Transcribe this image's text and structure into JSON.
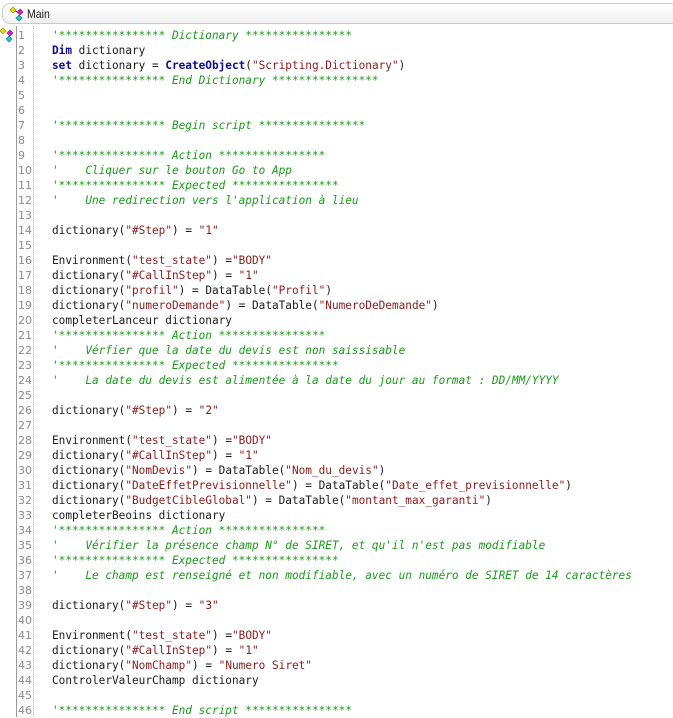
{
  "tab": {
    "label": "Main",
    "icon": "action-diamonds-icon"
  },
  "gutter": {
    "marker_icon": "action-diamonds-icon"
  },
  "colors": {
    "keyword": "#0a0a8c",
    "string": "#8b1a1a",
    "comment": "#1a9a1a",
    "line_number": "#8a8a8a",
    "text": "#1a1a1a"
  },
  "lines": [
    {
      "n": "1",
      "tokens": [
        [
          "cm",
          "'**************** Dictionary ****************"
        ]
      ]
    },
    {
      "n": "2",
      "tokens": [
        [
          "kw",
          "Dim"
        ],
        [
          "op",
          " dictionary"
        ]
      ]
    },
    {
      "n": "3",
      "tokens": [
        [
          "kw",
          "set"
        ],
        [
          "op",
          " dictionary = "
        ],
        [
          "fn",
          "CreateObject"
        ],
        [
          "op",
          "("
        ],
        [
          "str",
          "\"Scripting.Dictionary\""
        ],
        [
          "op",
          ")"
        ]
      ]
    },
    {
      "n": "4",
      "tokens": [
        [
          "cm",
          "'**************** End Dictionary ****************"
        ]
      ]
    },
    {
      "n": "5",
      "tokens": []
    },
    {
      "n": "6",
      "tokens": []
    },
    {
      "n": "7",
      "tokens": [
        [
          "cm",
          "'**************** Begin script ****************"
        ]
      ]
    },
    {
      "n": "8",
      "tokens": []
    },
    {
      "n": "9",
      "tokens": [
        [
          "cm",
          "'**************** Action ****************"
        ]
      ]
    },
    {
      "n": "10",
      "tokens": [
        [
          "cm",
          "'    Cliquer sur le bouton Go to App"
        ]
      ]
    },
    {
      "n": "11",
      "tokens": [
        [
          "cm",
          "'**************** Expected ****************"
        ]
      ]
    },
    {
      "n": "12",
      "tokens": [
        [
          "cm",
          "'    Une redirection vers l'application à lieu"
        ]
      ]
    },
    {
      "n": "13",
      "tokens": []
    },
    {
      "n": "14",
      "tokens": [
        [
          "op",
          "dictionary("
        ],
        [
          "str",
          "\"#Step\""
        ],
        [
          "op",
          ") = "
        ],
        [
          "str",
          "\"1\""
        ]
      ]
    },
    {
      "n": "15",
      "tokens": []
    },
    {
      "n": "16",
      "tokens": [
        [
          "op",
          "Environment("
        ],
        [
          "str",
          "\"test_state\""
        ],
        [
          "op",
          ") ="
        ],
        [
          "str",
          "\"BODY\""
        ]
      ]
    },
    {
      "n": "17",
      "tokens": [
        [
          "op",
          "dictionary("
        ],
        [
          "str",
          "\"#CallInStep\""
        ],
        [
          "op",
          ") = "
        ],
        [
          "str",
          "\"1\""
        ]
      ]
    },
    {
      "n": "18",
      "tokens": [
        [
          "op",
          "dictionary("
        ],
        [
          "str",
          "\"profil\""
        ],
        [
          "op",
          ") = DataTable("
        ],
        [
          "str",
          "\"Profil\""
        ],
        [
          "op",
          ")"
        ]
      ]
    },
    {
      "n": "19",
      "tokens": [
        [
          "op",
          "dictionary("
        ],
        [
          "str",
          "\"numeroDemande\""
        ],
        [
          "op",
          ") = DataTable("
        ],
        [
          "str",
          "\"NumeroDeDemande\""
        ],
        [
          "op",
          ")"
        ]
      ]
    },
    {
      "n": "20",
      "tokens": [
        [
          "op",
          "completerLanceur dictionary"
        ]
      ]
    },
    {
      "n": "21",
      "tokens": [
        [
          "cm",
          "'**************** Action ****************"
        ]
      ]
    },
    {
      "n": "22",
      "tokens": [
        [
          "cm",
          "'    Vérfier que la date du devis est non saissisable"
        ]
      ]
    },
    {
      "n": "23",
      "tokens": [
        [
          "cm",
          "'**************** Expected ****************"
        ]
      ]
    },
    {
      "n": "24",
      "tokens": [
        [
          "cm",
          "'    La date du devis est alimentée à la date du jour au format : DD/MM/YYYY"
        ]
      ]
    },
    {
      "n": "25",
      "tokens": []
    },
    {
      "n": "26",
      "tokens": [
        [
          "op",
          "dictionary("
        ],
        [
          "str",
          "\"#Step\""
        ],
        [
          "op",
          ") = "
        ],
        [
          "str",
          "\"2\""
        ]
      ]
    },
    {
      "n": "27",
      "tokens": []
    },
    {
      "n": "28",
      "tokens": [
        [
          "op",
          "Environment("
        ],
        [
          "str",
          "\"test_state\""
        ],
        [
          "op",
          ") ="
        ],
        [
          "str",
          "\"BODY\""
        ]
      ]
    },
    {
      "n": "29",
      "tokens": [
        [
          "op",
          "dictionary("
        ],
        [
          "str",
          "\"#CallInStep\""
        ],
        [
          "op",
          ") = "
        ],
        [
          "str",
          "\"1\""
        ]
      ]
    },
    {
      "n": "30",
      "tokens": [
        [
          "op",
          "dictionary("
        ],
        [
          "str",
          "\"NomDevis\""
        ],
        [
          "op",
          ") = DataTable("
        ],
        [
          "str",
          "\"Nom_du_devis\""
        ],
        [
          "op",
          ")"
        ]
      ]
    },
    {
      "n": "31",
      "tokens": [
        [
          "op",
          "dictionary("
        ],
        [
          "str",
          "\"DateEffetPrevisionnelle\""
        ],
        [
          "op",
          ") = DataTable("
        ],
        [
          "str",
          "\"Date_effet_previsionnelle\""
        ],
        [
          "op",
          ")"
        ]
      ]
    },
    {
      "n": "32",
      "tokens": [
        [
          "op",
          "dictionary("
        ],
        [
          "str",
          "\"BudgetCibleGlobal\""
        ],
        [
          "op",
          ") = DataTable("
        ],
        [
          "str",
          "\"montant_max_garanti\""
        ],
        [
          "op",
          ")"
        ]
      ]
    },
    {
      "n": "33",
      "tokens": [
        [
          "op",
          "completerBeoins dictionary"
        ]
      ]
    },
    {
      "n": "34",
      "tokens": [
        [
          "cm",
          "'**************** Action ****************"
        ]
      ]
    },
    {
      "n": "35",
      "tokens": [
        [
          "cm",
          "'    Vérifier la présence champ N° de SIRET, et qu'il n'est pas modifiable"
        ]
      ]
    },
    {
      "n": "36",
      "tokens": [
        [
          "cm",
          "'**************** Expected ****************"
        ]
      ]
    },
    {
      "n": "37",
      "tokens": [
        [
          "cm",
          "'    Le champ est renseigné et non modifiable, avec un numéro de SIRET de 14 caractères"
        ]
      ]
    },
    {
      "n": "38",
      "tokens": []
    },
    {
      "n": "39",
      "tokens": [
        [
          "op",
          "dictionary("
        ],
        [
          "str",
          "\"#Step\""
        ],
        [
          "op",
          ") = "
        ],
        [
          "str",
          "\"3\""
        ]
      ]
    },
    {
      "n": "40",
      "tokens": []
    },
    {
      "n": "41",
      "tokens": [
        [
          "op",
          "Environment("
        ],
        [
          "str",
          "\"test_state\""
        ],
        [
          "op",
          ") ="
        ],
        [
          "str",
          "\"BODY\""
        ]
      ]
    },
    {
      "n": "42",
      "tokens": [
        [
          "op",
          "dictionary("
        ],
        [
          "str",
          "\"#CallInStep\""
        ],
        [
          "op",
          ") = "
        ],
        [
          "str",
          "\"1\""
        ]
      ]
    },
    {
      "n": "43",
      "tokens": [
        [
          "op",
          "dictionary("
        ],
        [
          "str",
          "\"NomChamp\""
        ],
        [
          "op",
          ") = "
        ],
        [
          "str",
          "\"Numero Siret\""
        ]
      ]
    },
    {
      "n": "44",
      "tokens": [
        [
          "op",
          "ControlerValeurChamp dictionary"
        ]
      ]
    },
    {
      "n": "45",
      "tokens": []
    },
    {
      "n": "46",
      "tokens": [
        [
          "cm",
          "'**************** End script ****************"
        ]
      ]
    }
  ]
}
